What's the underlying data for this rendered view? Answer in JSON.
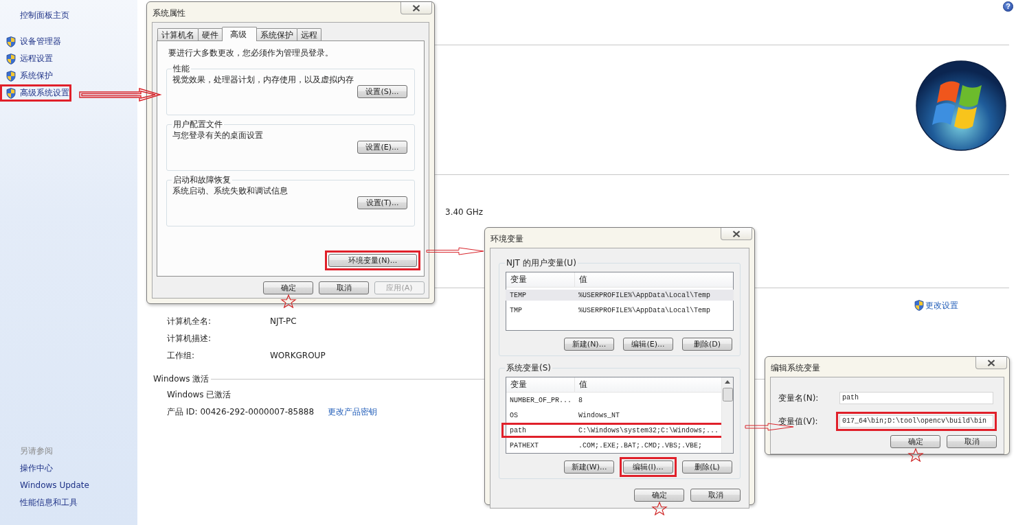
{
  "sidebar": {
    "home_link": "控制面板主页",
    "items": [
      {
        "label": "设备管理器",
        "highlighted": false
      },
      {
        "label": "远程设置",
        "highlighted": false
      },
      {
        "label": "系统保护",
        "highlighted": false
      },
      {
        "label": "高级系统设置",
        "highlighted": true
      }
    ],
    "see_also": {
      "title": "另请参阅",
      "links": [
        "操作中心",
        "Windows Update",
        "性能信息和工具"
      ]
    }
  },
  "main": {
    "help_button": "?",
    "cpu_speed": "3.40 GHz",
    "change_settings": "更改设置",
    "computer_rows": [
      {
        "label": "计算机全名:",
        "value": "NJT-PC"
      },
      {
        "label": "计算机描述:"
      },
      {
        "label": "工作组:",
        "value": "WORKGROUP"
      }
    ],
    "activation": {
      "title": "Windows 激活",
      "status": "Windows 已激活",
      "product_id": "产品 ID: 00426-292-0000007-85888",
      "change_key": "更改产品密钥"
    }
  },
  "system_properties": {
    "title": "系统属性",
    "tabs": [
      {
        "label": "计算机名",
        "selected": false
      },
      {
        "label": "硬件",
        "selected": false
      },
      {
        "label": "高级",
        "selected": true
      },
      {
        "label": "系统保护",
        "selected": false
      },
      {
        "label": "远程",
        "selected": false
      }
    ],
    "note": "要进行大多数更改，您必须作为管理员登录。",
    "groups": [
      {
        "title": "性能",
        "description": "视觉效果，处理器计划，内存使用，以及虚拟内存",
        "button": "设置(S)..."
      },
      {
        "title": "用户配置文件",
        "description": "与您登录有关的桌面设置",
        "button": "设置(E)..."
      },
      {
        "title": "启动和故障恢复",
        "description": "系统启动、系统失败和调试信息",
        "button": "设置(T)..."
      }
    ],
    "env_button": {
      "label": "环境变量(N)...",
      "highlighted": true
    },
    "buttons": [
      {
        "label": "确定",
        "disabled": false,
        "starred": true
      },
      {
        "label": "取消",
        "disabled": false,
        "starred": false
      },
      {
        "label": "应用(A)",
        "disabled": true,
        "starred": false
      }
    ]
  },
  "environment_variables": {
    "title": "环境变量",
    "user_vars": {
      "title": "NJT 的用户变量(U)",
      "columns": [
        "变量",
        "值"
      ],
      "rows": [
        {
          "name": "TEMP",
          "value": "%USERPROFILE%\\AppData\\Local\\Temp",
          "selected": true,
          "highlighted": false
        },
        {
          "name": "TMP",
          "value": "%USERPROFILE%\\AppData\\Local\\Temp",
          "selected": false,
          "highlighted": false
        }
      ],
      "buttons": [
        {
          "label": "新建(N)...",
          "highlighted": false
        },
        {
          "label": "编辑(E)...",
          "highlighted": false
        },
        {
          "label": "删除(D)",
          "highlighted": false
        }
      ]
    },
    "system_vars": {
      "title": "系统变量(S)",
      "columns": [
        "变量",
        "值"
      ],
      "rows": [
        {
          "name": "NUMBER_OF_PR...",
          "value": "8",
          "selected": false,
          "highlighted": false
        },
        {
          "name": "OS",
          "value": "Windows_NT",
          "selected": false,
          "highlighted": false
        },
        {
          "name": "path",
          "value": "C:\\Windows\\system32;C:\\Windows;...",
          "selected": false,
          "highlighted": true
        },
        {
          "name": "PATHEXT",
          "value": ".COM;.EXE;.BAT;.CMD;.VBS;.VBE;",
          "selected": false,
          "highlighted": false
        }
      ],
      "buttons": [
        {
          "label": "新建(W)...",
          "highlighted": false
        },
        {
          "label": "编辑(I)...",
          "highlighted": true
        },
        {
          "label": "删除(L)",
          "highlighted": false
        }
      ]
    },
    "buttons": [
      {
        "label": "确定",
        "starred": true
      },
      {
        "label": "取消",
        "starred": false
      }
    ]
  },
  "edit_variable": {
    "title": "编辑系统变量",
    "fields": [
      {
        "label": "变量名(N):",
        "value": "path",
        "highlighted": false
      },
      {
        "label": "变量值(V):",
        "value": "017_64\\bin;D:\\tool\\opencv\\build\\bin",
        "highlighted": true
      }
    ],
    "buttons": [
      {
        "label": "确定",
        "starred": true
      },
      {
        "label": "取消",
        "starred": false
      }
    ]
  }
}
